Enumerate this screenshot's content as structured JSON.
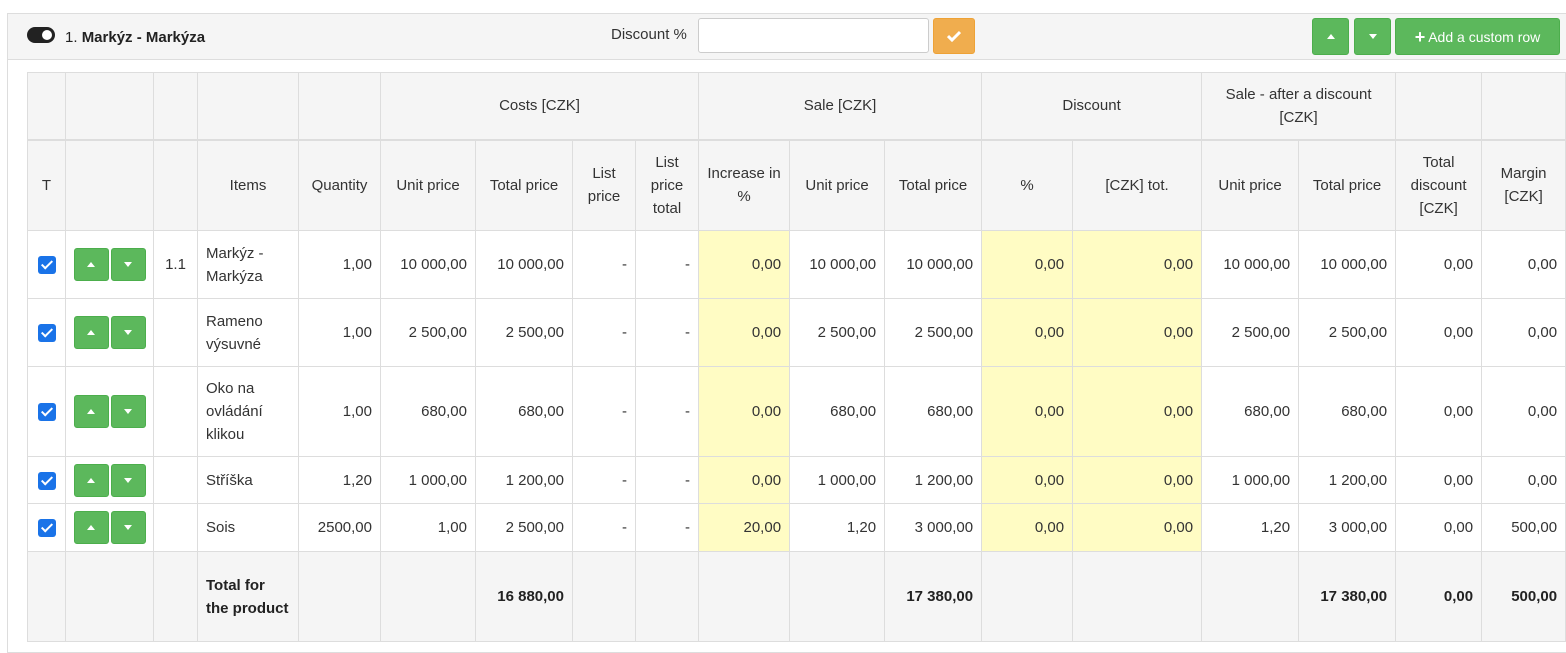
{
  "header": {
    "product_number": "1.",
    "product_name": "Markýz - Markýza",
    "discount_label": "Discount %",
    "discount_value": "",
    "confirm_icon": "check-icon",
    "add_row_label": "Add a custom row"
  },
  "colors": {
    "green": "#5cb85c",
    "orange": "#f0ad4e",
    "yellow_cell": "#fffcc4",
    "checkbox": "#1a73e8"
  },
  "table": {
    "group_headers": {
      "costs": "Costs [CZK]",
      "sale": "Sale [CZK]",
      "discount": "Discount",
      "sale_after_discount": "Sale - after a discount [CZK]"
    },
    "columns": {
      "t": "T",
      "items": "Items",
      "quantity": "Quantity",
      "cost_unit": "Unit price",
      "cost_total": "Total price",
      "list_price": "List price",
      "list_price_total": "List price total",
      "increase": "Increase in %",
      "sale_unit": "Unit price",
      "sale_total": "Total price",
      "disc_pct": "%",
      "disc_czk": "[CZK] tot.",
      "after_unit": "Unit price",
      "after_total": "Total price",
      "total_discount": "Total discount [CZK]",
      "margin": "Margin [CZK]"
    },
    "rows": [
      {
        "no": "1.1",
        "item": "Markýz - Markýza",
        "qty": "1,00",
        "cost_unit": "10 000,00",
        "cost_total": "10 000,00",
        "list": "-",
        "list_total": "-",
        "increase": "0,00",
        "sale_unit": "10 000,00",
        "sale_total": "10 000,00",
        "disc_pct": "0,00",
        "disc_czk": "0,00",
        "after_unit": "10 000,00",
        "after_total": "10 000,00",
        "total_discount": "0,00",
        "margin": "0,00"
      },
      {
        "no": "",
        "item": "Rameno výsuvné",
        "qty": "1,00",
        "cost_unit": "2 500,00",
        "cost_total": "2 500,00",
        "list": "-",
        "list_total": "-",
        "increase": "0,00",
        "sale_unit": "2 500,00",
        "sale_total": "2 500,00",
        "disc_pct": "0,00",
        "disc_czk": "0,00",
        "after_unit": "2 500,00",
        "after_total": "2 500,00",
        "total_discount": "0,00",
        "margin": "0,00"
      },
      {
        "no": "",
        "item": "Oko na ovládání klikou",
        "qty": "1,00",
        "cost_unit": "680,00",
        "cost_total": "680,00",
        "list": "-",
        "list_total": "-",
        "increase": "0,00",
        "sale_unit": "680,00",
        "sale_total": "680,00",
        "disc_pct": "0,00",
        "disc_czk": "0,00",
        "after_unit": "680,00",
        "after_total": "680,00",
        "total_discount": "0,00",
        "margin": "0,00"
      },
      {
        "no": "",
        "item": "Stříška",
        "qty": "1,20",
        "cost_unit": "1 000,00",
        "cost_total": "1 200,00",
        "list": "-",
        "list_total": "-",
        "increase": "0,00",
        "sale_unit": "1 000,00",
        "sale_total": "1 200,00",
        "disc_pct": "0,00",
        "disc_czk": "0,00",
        "after_unit": "1 000,00",
        "after_total": "1 200,00",
        "total_discount": "0,00",
        "margin": "0,00"
      },
      {
        "no": "",
        "item": "Sois",
        "qty": "2500,00",
        "cost_unit": "1,00",
        "cost_total": "2 500,00",
        "list": "-",
        "list_total": "-",
        "increase": "20,00",
        "sale_unit": "1,20",
        "sale_total": "3 000,00",
        "disc_pct": "0,00",
        "disc_czk": "0,00",
        "after_unit": "1,20",
        "after_total": "3 000,00",
        "total_discount": "0,00",
        "margin": "500,00"
      }
    ],
    "total": {
      "label": "Total for the product",
      "cost_total": "16 880,00",
      "sale_total": "17 380,00",
      "after_total": "17 380,00",
      "total_discount": "0,00",
      "margin": "500,00"
    }
  }
}
